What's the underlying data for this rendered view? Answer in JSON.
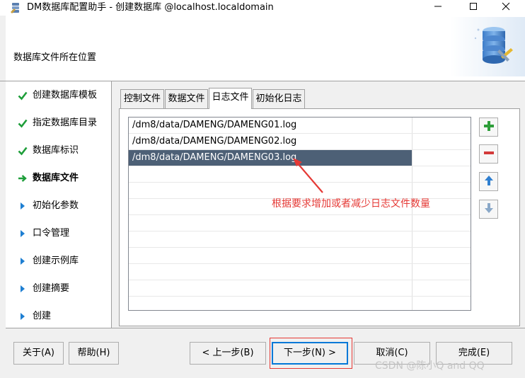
{
  "window": {
    "title": "DM数据库配置助手 - 创建数据库 @localhost.localdomain",
    "minimize_icon": "minimize-icon",
    "maximize_icon": "maximize-icon",
    "close_icon": "close-icon"
  },
  "header": {
    "title": "数据库文件所在位置",
    "graphic_icon": "database-settings-icon"
  },
  "nav": {
    "items": [
      {
        "label": "创建数据库模板",
        "state": "done",
        "icon": "check-icon"
      },
      {
        "label": "指定数据库目录",
        "state": "done",
        "icon": "check-icon"
      },
      {
        "label": "数据库标识",
        "state": "done",
        "icon": "check-icon"
      },
      {
        "label": "数据库文件",
        "state": "current",
        "icon": "arrow-right-icon"
      },
      {
        "label": "初始化参数",
        "state": "pending",
        "icon": "triangle-right-icon"
      },
      {
        "label": "口令管理",
        "state": "pending",
        "icon": "triangle-right-icon"
      },
      {
        "label": "创建示例库",
        "state": "pending",
        "icon": "triangle-right-icon"
      },
      {
        "label": "创建摘要",
        "state": "pending",
        "icon": "triangle-right-icon"
      },
      {
        "label": "创建",
        "state": "pending",
        "icon": "triangle-right-icon"
      }
    ]
  },
  "tabs": [
    {
      "label": "控制文件",
      "active": false
    },
    {
      "label": "数据文件",
      "active": false
    },
    {
      "label": "日志文件",
      "active": true
    },
    {
      "label": "初始化日志",
      "active": false
    }
  ],
  "log_files": {
    "rows": [
      {
        "path": "/dm8/data/DAMENG/DAMENG01.log",
        "selected": false
      },
      {
        "path": "/dm8/data/DAMENG/DAMENG02.log",
        "selected": false
      },
      {
        "path": "/dm8/data/DAMENG/DAMENG03.log",
        "selected": true
      }
    ],
    "empty_rows": 9
  },
  "side_buttons": [
    {
      "name": "add-button",
      "icon": "plus-icon"
    },
    {
      "name": "remove-button",
      "icon": "minus-icon"
    },
    {
      "name": "move-up-button",
      "icon": "arrow-up-icon"
    },
    {
      "name": "move-down-button",
      "icon": "arrow-down-icon"
    }
  ],
  "annotation": {
    "text": "根据要求增加或者减少日志文件数量",
    "color": "#e53935"
  },
  "buttons": {
    "about": "关于(A)",
    "help": "帮助(H)",
    "prev": "< 上一步(B)",
    "next": "下一步(N) >",
    "cancel": "取消(C)",
    "finish": "完成(E)"
  },
  "watermark": "CSDN @陈小Q and QQ",
  "colors": {
    "check": "#1e9e3a",
    "current_arrow": "#1e9e3a",
    "pending_triangle": "#1e7fd2",
    "selection": "#4d6076",
    "add": "#2e9e3a",
    "remove": "#d33a3a",
    "move": "#2f7fd0",
    "annotation": "#e53935",
    "focus_border": "#0078d7"
  }
}
